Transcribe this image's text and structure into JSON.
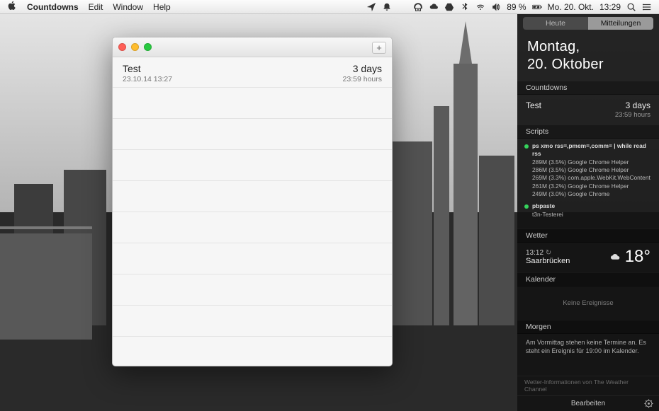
{
  "menubar": {
    "app_name": "Countdowns",
    "menus": [
      "Edit",
      "Window",
      "Help"
    ],
    "battery": "89 %",
    "date": "Mo. 20. Okt.",
    "time": "13:29"
  },
  "window": {
    "add_glyph": "+",
    "items": [
      {
        "title": "Test",
        "countdown": "3 days",
        "due_date": "23.10.14 13:27",
        "time_left": "23:59 hours"
      }
    ]
  },
  "nc": {
    "tabs": {
      "today": "Heute",
      "notifications": "Mitteilungen"
    },
    "date_line1": "Montag,",
    "date_line2": "20. Oktober",
    "sections": {
      "countdowns": "Countdowns",
      "scripts": "Scripts",
      "weather": "Wetter",
      "calendar": "Kalender",
      "tomorrow": "Morgen"
    },
    "countdown": {
      "title": "Test",
      "days": "3 days",
      "hours": "23:59 hours"
    },
    "scripts": [
      {
        "cmd": "ps xmo rss=,pmem=,comm= | while read rss",
        "lines": [
          "289M (3.5%) Google Chrome Helper",
          "286M (3.5%) Google Chrome Helper",
          "269M (3.3%) com.apple.WebKit.WebContent",
          "261M (3.2%) Google Chrome Helper",
          "249M (3.0%) Google Chrome"
        ]
      },
      {
        "cmd": "pbpaste",
        "lines": [
          "t3n-Testerei"
        ]
      }
    ],
    "weather": {
      "time": "13:12",
      "reload": "↻",
      "location": "Saarbrücken",
      "temp": "18°"
    },
    "calendar_empty": "Keine Ereignisse",
    "tomorrow_text": "Am Vormittag stehen keine Termine an. Es steht ein Ereignis für 19:00 im Kalender.",
    "attribution": "Wetter-Informationen von The Weather Channel",
    "edit_button": "Bearbeiten"
  }
}
